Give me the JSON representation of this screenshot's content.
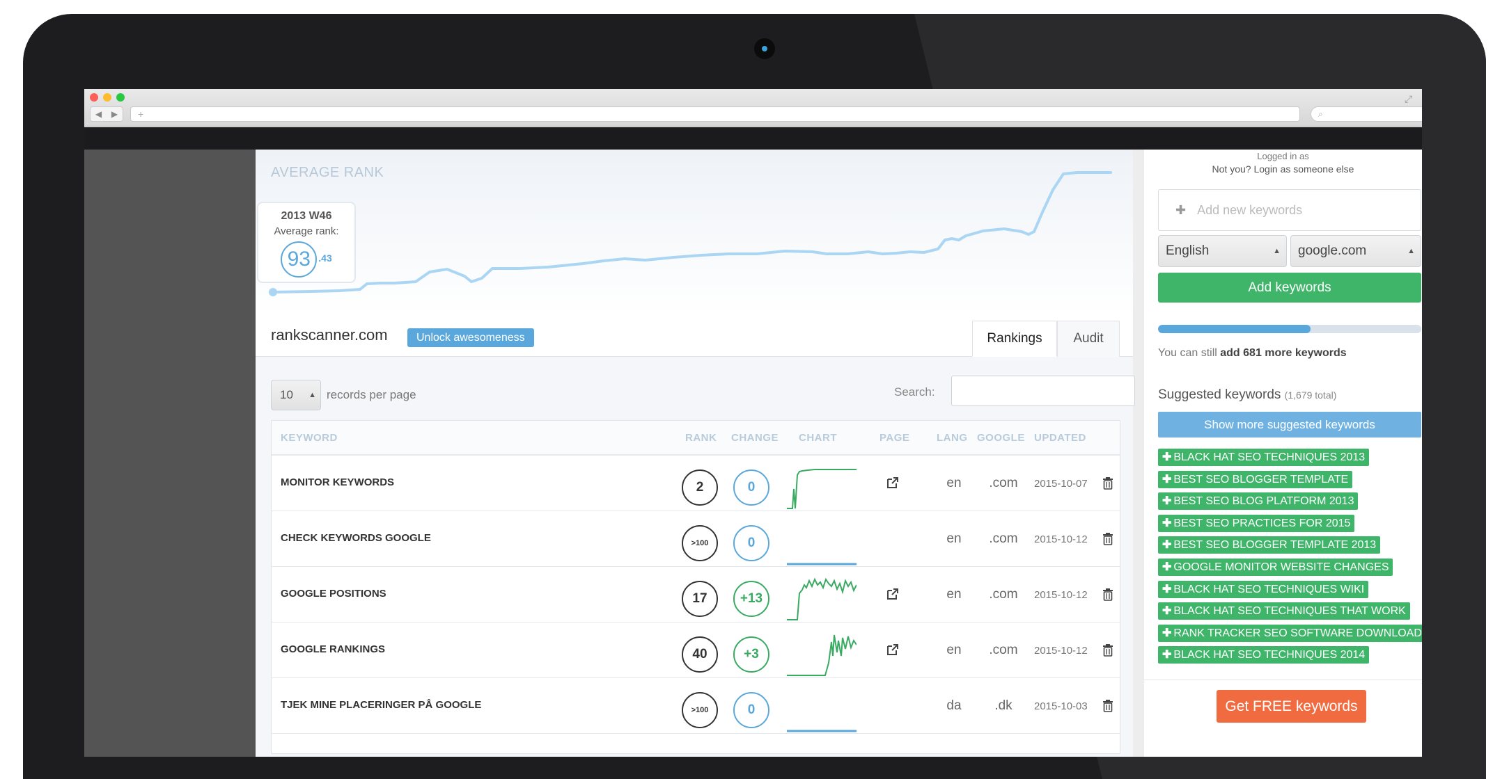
{
  "main": {
    "chart_title": "AVERAGE RANK",
    "tooltip": {
      "week": "2013 W46",
      "label": "Average rank:",
      "value": "93",
      "decimal": ".43"
    },
    "site": "rankscanner.com",
    "unlock_label": "Unlock awesomeness",
    "tabs": [
      {
        "label": "Rankings",
        "active": true
      },
      {
        "label": "Audit",
        "active": false
      }
    ],
    "records_per_page": {
      "value": "10",
      "label": "records per page"
    },
    "search_label": "Search:",
    "columns": [
      "KEYWORD",
      "RANK",
      "CHANGE",
      "CHART",
      "PAGE",
      "LANG",
      "GOOGLE",
      "UPDATED"
    ],
    "rows": [
      {
        "keyword": "MONITOR KEYWORDS",
        "rank": "2",
        "change": "0",
        "has_page": true,
        "lang": "en",
        "google": ".com",
        "updated": "2015-10-07"
      },
      {
        "keyword": "CHECK KEYWORDS GOOGLE",
        "rank": ">100",
        "change": "0",
        "has_page": false,
        "lang": "en",
        "google": ".com",
        "updated": "2015-10-12"
      },
      {
        "keyword": "GOOGLE POSITIONS",
        "rank": "17",
        "change": "+13",
        "has_page": true,
        "lang": "en",
        "google": ".com",
        "updated": "2015-10-12"
      },
      {
        "keyword": "GOOGLE RANKINGS",
        "rank": "40",
        "change": "+3",
        "has_page": true,
        "lang": "en",
        "google": ".com",
        "updated": "2015-10-12"
      },
      {
        "keyword": "TJEK MINE PLACERINGER PÅ GOOGLE",
        "rank": ">100",
        "change": "0",
        "has_page": false,
        "lang": "da",
        "google": ".dk",
        "updated": "2015-10-03"
      }
    ]
  },
  "right": {
    "logged_in": "Logged in as",
    "not_you": "Not you? Login as someone else",
    "add_placeholder": "Add new keywords",
    "language": "English",
    "engine": "google.com",
    "add_button": "Add keywords",
    "progress": 0.58,
    "remaining_prefix": "You can still",
    "remaining_bold": "add 681 more keywords",
    "suggested_title": "Suggested keywords",
    "suggested_count": "(1,679 total)",
    "show_more": "Show more suggested keywords",
    "tags": [
      "BLACK HAT SEO TECHNIQUES 2013",
      "BEST SEO BLOGGER TEMPLATE",
      "BEST SEO BLOG PLATFORM 2013",
      "BEST SEO PRACTICES FOR 2015",
      "BEST SEO BLOGGER TEMPLATE 2013",
      "GOOGLE MONITOR WEBSITE CHANGES",
      "BLACK HAT SEO TECHNIQUES WIKI",
      "BLACK HAT SEO TECHNIQUES THAT WORK",
      "RANK TRACKER SEO SOFTWARE DOWNLOAD",
      "BLACK HAT SEO TECHNIQUES 2014"
    ],
    "free_button": "Get FREE keywords"
  },
  "colors": {
    "accent_blue": "#5aa7dc",
    "green": "#3fb56a",
    "orange": "#f06b40"
  }
}
